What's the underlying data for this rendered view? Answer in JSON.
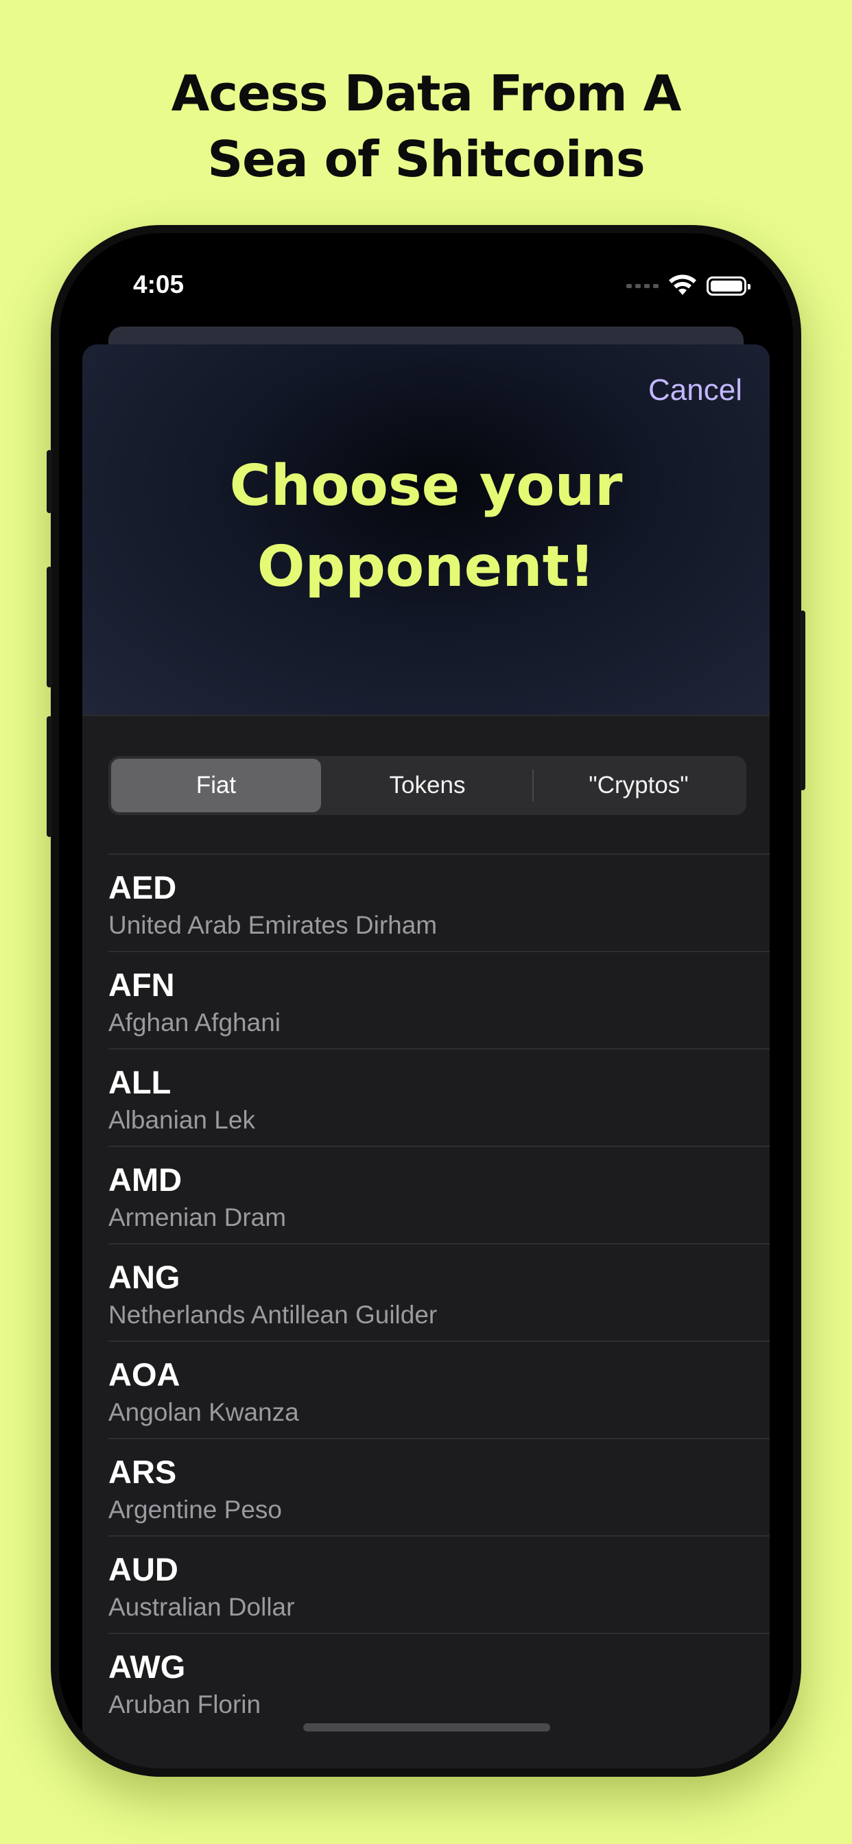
{
  "headline": {
    "line1": "Acess Data From A",
    "line2": "Sea of Shitcoins"
  },
  "status_bar": {
    "time": "4:05",
    "icons": [
      "signal-dots-icon",
      "wifi-icon",
      "battery-icon"
    ]
  },
  "sheet": {
    "cancel_label": "Cancel",
    "title_line1": "Choose your",
    "title_line2": "Opponent!"
  },
  "segments": [
    {
      "label": "Fiat",
      "selected": true
    },
    {
      "label": "Tokens",
      "selected": false
    },
    {
      "label": "\"Cryptos\"",
      "selected": false
    }
  ],
  "currencies": [
    {
      "code": "AED",
      "name": "United Arab Emirates Dirham"
    },
    {
      "code": "AFN",
      "name": "Afghan Afghani"
    },
    {
      "code": "ALL",
      "name": "Albanian Lek"
    },
    {
      "code": "AMD",
      "name": "Armenian Dram"
    },
    {
      "code": "ANG",
      "name": "Netherlands Antillean Guilder"
    },
    {
      "code": "AOA",
      "name": "Angolan Kwanza"
    },
    {
      "code": "ARS",
      "name": "Argentine Peso"
    },
    {
      "code": "AUD",
      "name": "Australian Dollar"
    },
    {
      "code": "AWG",
      "name": "Aruban Florin"
    }
  ],
  "colors": {
    "background": "#e8fb8c",
    "title_accent": "#e4fa74",
    "cancel": "#c3b7ff",
    "sheet": "#1c1c1e"
  }
}
